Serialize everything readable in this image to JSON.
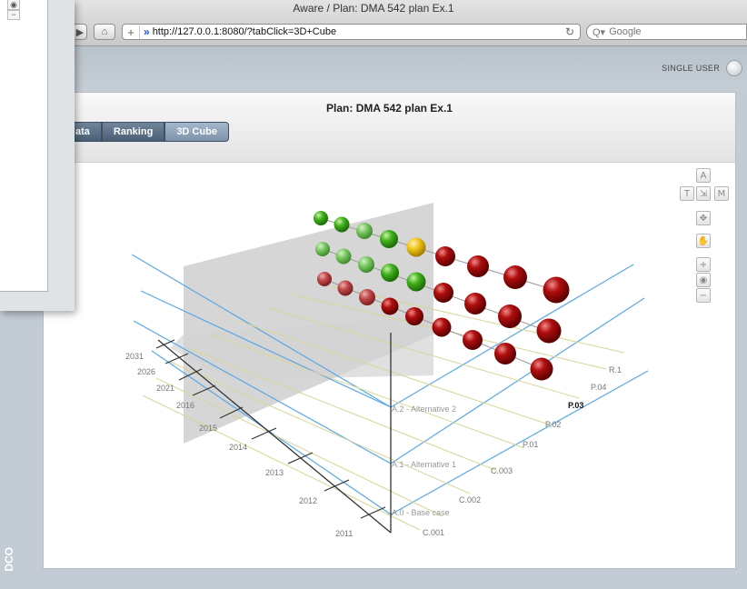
{
  "browser": {
    "window_title": "Aware / Plan: DMA 542 plan Ex.1",
    "url": "http://127.0.0.1:8080/?tabClick=3D+Cube",
    "search_placeholder": "Google",
    "back_glyph": "◀",
    "forward_glyph": "▶",
    "home_glyph": "⌂",
    "plus_glyph": "+",
    "reload_glyph": "↻"
  },
  "app": {
    "mode_label": "SINGLE USER",
    "plan_title": "Plan: DMA 542 plan Ex.1",
    "tabs": [
      {
        "label": "ata",
        "active": false
      },
      {
        "label": "Ranking",
        "active": false
      },
      {
        "label": "3D Cube",
        "active": true
      }
    ],
    "side_logo": "DCO"
  },
  "nav_controls": {
    "view_a": "A",
    "view_t": "T",
    "view_mid": "⇲",
    "view_m": "M",
    "pan_icon": "✥",
    "hand_icon": "✋",
    "zoom_in": "+",
    "globe_icon": "◉",
    "zoom_out": "−"
  },
  "overlay_window": {
    "globe_glyph": "◉",
    "minus_glyph": "−"
  },
  "cube": {
    "colors": {
      "green": "#3fb01a",
      "light_green": "#6fc95a",
      "yellow": "#f0c419",
      "red": "#b00e0e",
      "light_red": "#c24848",
      "blue_grid": "#5aa8e6",
      "yellow_grid": "#d8d59a"
    },
    "year_labels": [
      "2031",
      "2026",
      "2021",
      "2016",
      "2015",
      "2014",
      "2013",
      "2012",
      "2011"
    ],
    "right_labels": [
      "R.1",
      "P.04",
      "P.03",
      "P.02",
      "P.01",
      "C.003",
      "C.002",
      "C.001"
    ],
    "alternative_labels": [
      "A.2 - Alternative 2",
      "A.1 - Alternative 1",
      "A.0 - Base case"
    ]
  }
}
